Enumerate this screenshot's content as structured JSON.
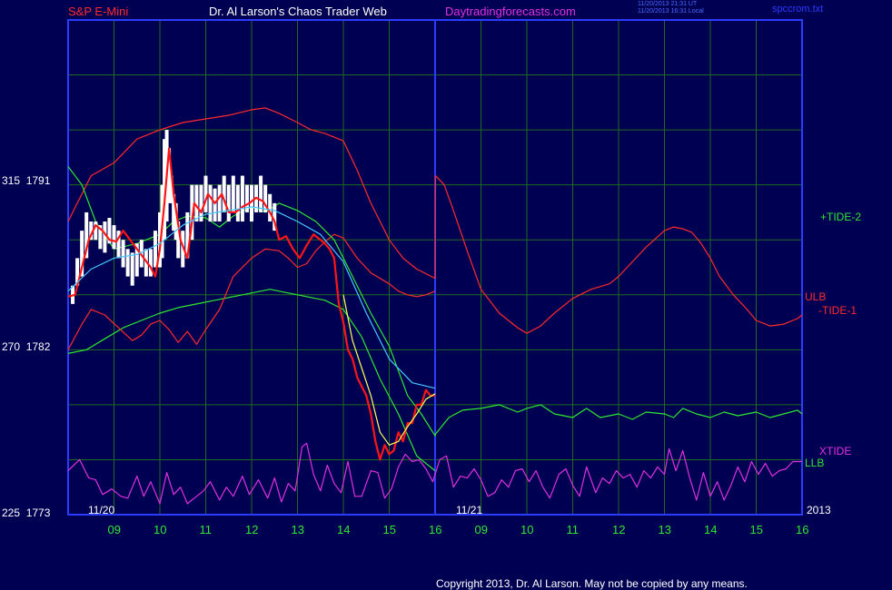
{
  "header": {
    "symbol": "S&P E-Mini",
    "title": "Dr. Al Larson's Chaos Trader Web",
    "site": "Daytradingforecasts.com",
    "stamp_line1": "11/20/2013 21:31 UT",
    "stamp_line2": "11/20/2013 16:31 Local",
    "file": "spccrom.txt"
  },
  "footer": {
    "copyright": "Copyright 2013, Dr. Al Larson. May not be copied by any means."
  },
  "colors": {
    "background": "#000052",
    "frame": "#2a3cff",
    "grid": "#1f6a1f",
    "price": "#ff1515",
    "candle_up": "#ffffff",
    "avg": "#ffff55",
    "ma_cyan": "#44c8ff",
    "tide2": "#2ee82e",
    "tide1": "#ff2a2a",
    "xtide": "#e030e0"
  },
  "chart_data": {
    "type": "line",
    "ylabels": [
      {
        "tide": "315",
        "price": "1791",
        "value": 1791
      },
      {
        "tide": "270",
        "price": "1782",
        "value": 1782
      },
      {
        "tide": "225",
        "price": "1773",
        "value": 1773
      }
    ],
    "ylim": [
      1773,
      1800
    ],
    "xlim": [
      8,
      24
    ],
    "grid": true,
    "date_labels": [
      {
        "text": "11/20",
        "x": 8.5
      },
      {
        "text": "11/21",
        "x": 16.5
      },
      {
        "text": "2013",
        "x": 24
      }
    ],
    "xticks": [
      {
        "label": "09",
        "x": 9
      },
      {
        "label": "10",
        "x": 10
      },
      {
        "label": "11",
        "x": 11
      },
      {
        "label": "12",
        "x": 12
      },
      {
        "label": "13",
        "x": 13
      },
      {
        "label": "14",
        "x": 14
      },
      {
        "label": "15",
        "x": 15
      },
      {
        "label": "16",
        "x": 16
      },
      {
        "label": "09",
        "x": 17
      },
      {
        "label": "10",
        "x": 18
      },
      {
        "label": "11",
        "x": 19
      },
      {
        "label": "12",
        "x": 20
      },
      {
        "label": "13",
        "x": 21
      },
      {
        "label": "14",
        "x": 22
      },
      {
        "label": "15",
        "x": 23
      },
      {
        "label": "16",
        "x": 24
      }
    ],
    "divider_x": 16,
    "series_labels": [
      {
        "name": "+TIDE-2",
        "color": "#2ee82e"
      },
      {
        "name": "ULB",
        "color": "#ff2a2a"
      },
      {
        "name": "-TIDE-1",
        "color": "#ff2a2a"
      },
      {
        "name": "XTIDE",
        "color": "#e030e0"
      },
      {
        "name": "LLB",
        "color": "#2ee82e"
      }
    ],
    "price": {
      "x": [
        8.0,
        8.15,
        8.3,
        8.45,
        8.6,
        8.75,
        8.9,
        9.05,
        9.2,
        9.35,
        9.5,
        9.65,
        9.8,
        9.9,
        10.0,
        10.1,
        10.2,
        10.3,
        10.45,
        10.6,
        10.75,
        10.9,
        11.05,
        11.2,
        11.35,
        11.5,
        11.65,
        11.8,
        11.95,
        12.1,
        12.25,
        12.4,
        12.5,
        12.6,
        12.75,
        12.9,
        13.05,
        13.2,
        13.35,
        13.5,
        13.6,
        13.7,
        13.8,
        13.9,
        14.0,
        14.1,
        14.2,
        14.3,
        14.4,
        14.5,
        14.6,
        14.7,
        14.8,
        14.9,
        15.0,
        15.1,
        15.2,
        15.3,
        15.4,
        15.5,
        15.6,
        15.7,
        15.8,
        15.9,
        16.0
      ],
      "y": [
        1784.9,
        1785.0,
        1786.5,
        1788.0,
        1788.8,
        1788.5,
        1788.0,
        1787.9,
        1788.5,
        1788.0,
        1787.5,
        1787.0,
        1786.5,
        1786.0,
        1787.5,
        1790.0,
        1793.0,
        1790.5,
        1788.0,
        1787.0,
        1790.0,
        1789.5,
        1790.5,
        1790.0,
        1790.5,
        1789.5,
        1789.5,
        1789.8,
        1790.0,
        1790.3,
        1790.1,
        1789.5,
        1789.0,
        1788.0,
        1788.2,
        1787.5,
        1787.0,
        1787.7,
        1788.3,
        1788.0,
        1787.8,
        1787.5,
        1787.0,
        1784.5,
        1783.5,
        1782.0,
        1781.5,
        1780.5,
        1780.0,
        1779.5,
        1778.5,
        1777.0,
        1776.0,
        1776.8,
        1776.3,
        1776.5,
        1777.5,
        1777.0,
        1778.0,
        1778.0,
        1779.0,
        1779.0,
        1779.8,
        1779.5,
        1779.5
      ]
    },
    "candles": {
      "x": [
        8.1,
        8.2,
        8.3,
        8.4,
        8.5,
        8.6,
        8.7,
        8.8,
        8.9,
        9.0,
        9.1,
        9.2,
        9.3,
        9.4,
        9.5,
        9.6,
        9.7,
        9.8,
        9.9,
        10.0,
        10.05,
        10.1,
        10.15,
        10.2,
        10.25,
        10.3,
        10.35,
        10.4,
        10.5,
        10.6,
        10.7,
        10.8,
        10.9,
        11.0,
        11.1,
        11.2,
        11.3,
        11.4,
        11.5,
        11.6,
        11.7,
        11.8,
        11.9,
        12.0,
        12.1,
        12.2,
        12.3,
        12.4,
        12.5
      ],
      "low": [
        1784.5,
        1785.5,
        1786.0,
        1787.0,
        1788.0,
        1788.0,
        1787.5,
        1787.3,
        1787.8,
        1787.5,
        1787.0,
        1786.5,
        1786.0,
        1785.5,
        1786.0,
        1786.5,
        1786.0,
        1786.0,
        1786.5,
        1786.5,
        1787.0,
        1788.0,
        1789.0,
        1790.0,
        1790.0,
        1788.5,
        1788.0,
        1787.0,
        1786.5,
        1787.0,
        1788.0,
        1789.0,
        1789.0,
        1789.5,
        1789.0,
        1789.0,
        1789.0,
        1789.5,
        1789.0,
        1789.5,
        1789.0,
        1789.0,
        1789.5,
        1789.0,
        1789.5,
        1789.5,
        1789.5,
        1789.0,
        1788.5
      ],
      "high": [
        1785.5,
        1787.0,
        1788.5,
        1789.5,
        1789.0,
        1789.0,
        1788.8,
        1789.0,
        1789.2,
        1788.8,
        1788.5,
        1788.0,
        1787.5,
        1787.3,
        1787.8,
        1788.0,
        1787.5,
        1787.5,
        1788.5,
        1789.5,
        1791.0,
        1793.5,
        1794.0,
        1793.0,
        1791.5,
        1790.5,
        1790.0,
        1789.0,
        1788.5,
        1789.5,
        1791.0,
        1791.0,
        1791.0,
        1791.5,
        1791.0,
        1790.8,
        1791.0,
        1791.5,
        1791.0,
        1791.5,
        1791.0,
        1791.5,
        1791.0,
        1791.0,
        1791.0,
        1791.5,
        1791.0,
        1790.5,
        1790.0
      ]
    },
    "avg": {
      "x": [
        14.0,
        14.2,
        14.4,
        14.6,
        14.8,
        15.0,
        15.2,
        15.4,
        15.6,
        15.8,
        16.0
      ],
      "y": [
        1785.0,
        1782.5,
        1781.0,
        1779.5,
        1777.5,
        1776.8,
        1777.0,
        1777.8,
        1778.5,
        1779.3,
        1779.6
      ]
    },
    "ma_cyan": {
      "x": [
        8.0,
        8.5,
        9.0,
        9.5,
        10.0,
        10.5,
        11.0,
        11.5,
        12.0,
        12.5,
        13.0,
        13.5,
        14.0,
        14.5,
        15.0,
        15.5,
        16.0
      ],
      "y": [
        1785.2,
        1786.4,
        1787.0,
        1787.2,
        1787.8,
        1788.8,
        1789.4,
        1789.6,
        1789.8,
        1789.6,
        1789.0,
        1788.3,
        1786.8,
        1784.0,
        1781.5,
        1780.2,
        1779.9
      ]
    },
    "tide2": {
      "x": [
        8.0,
        8.3,
        8.6,
        9.0,
        9.5,
        10.0,
        10.3,
        10.6,
        11.0,
        11.3,
        11.6,
        12.0,
        12.3,
        12.6,
        13.0,
        13.4,
        13.8,
        14.2,
        14.6,
        15.0,
        15.4,
        15.7,
        16.0,
        16.01,
        16.3,
        16.6,
        17.0,
        17.4,
        17.8,
        18.0,
        18.3,
        18.6,
        19.0,
        19.3,
        19.6,
        20.0,
        20.3,
        20.6,
        21.0,
        21.2,
        21.4,
        21.7,
        22.0,
        22.3,
        22.6,
        23.0,
        23.3,
        23.6,
        23.9,
        24.0
      ],
      "y": [
        1792.0,
        1791.0,
        1789.0,
        1787.5,
        1787.8,
        1788.3,
        1789.0,
        1789.3,
        1789.2,
        1788.7,
        1789.3,
        1789.8,
        1789.5,
        1790.0,
        1789.6,
        1789.0,
        1788.0,
        1786.0,
        1784.0,
        1782.2,
        1779.5,
        1778.5,
        1777.3,
        1777.4,
        1778.3,
        1778.7,
        1778.8,
        1779.0,
        1778.6,
        1778.8,
        1779.0,
        1778.5,
        1778.3,
        1778.8,
        1778.3,
        1778.5,
        1778.2,
        1778.6,
        1778.5,
        1778.3,
        1778.8,
        1778.5,
        1778.3,
        1778.6,
        1778.4,
        1778.6,
        1778.3,
        1778.5,
        1778.7,
        1778.5
      ]
    },
    "ulb": {
      "x": [
        8.0,
        8.5,
        9.0,
        9.5,
        10.0,
        10.5,
        11.0,
        11.5,
        12.0,
        12.3,
        12.6,
        13.0,
        13.3,
        13.6,
        14.0,
        14.3,
        14.6,
        15.0,
        15.3,
        15.6,
        16.0,
        16.01,
        16.2,
        16.4,
        16.7,
        17.0,
        17.4,
        17.8,
        18.0,
        18.3,
        18.6,
        19.0,
        19.4,
        19.8,
        20.0,
        20.3,
        20.6,
        21.0,
        21.2,
        21.4,
        21.6,
        21.8,
        22.0,
        22.2,
        22.5,
        22.8,
        23.0,
        23.3,
        23.6,
        23.9,
        24.0
      ],
      "y": [
        1789.0,
        1791.5,
        1792.2,
        1793.5,
        1794.0,
        1794.4,
        1794.6,
        1794.8,
        1795.1,
        1795.2,
        1794.9,
        1794.4,
        1794.0,
        1793.8,
        1793.4,
        1791.8,
        1790.0,
        1788.0,
        1787.0,
        1786.4,
        1785.9,
        1791.5,
        1791.0,
        1789.6,
        1787.4,
        1785.3,
        1784.0,
        1783.2,
        1782.9,
        1783.3,
        1784.0,
        1784.8,
        1785.3,
        1785.6,
        1786.0,
        1786.8,
        1787.6,
        1788.5,
        1788.7,
        1788.6,
        1788.4,
        1787.8,
        1787.0,
        1786.0,
        1785.0,
        1784.2,
        1783.6,
        1783.3,
        1783.4,
        1783.7,
        1783.9
      ]
    },
    "llb": {
      "x": [
        8.0,
        8.4,
        8.8,
        9.2,
        9.6,
        10.0,
        10.4,
        10.8,
        11.2,
        11.6,
        12.0,
        12.4,
        12.8,
        13.2,
        13.6,
        14.0,
        14.4,
        14.8,
        15.2,
        15.6,
        16.0
      ],
      "y": [
        1781.8,
        1782.0,
        1782.6,
        1783.2,
        1783.6,
        1784.0,
        1784.3,
        1784.5,
        1784.7,
        1784.9,
        1785.1,
        1785.3,
        1785.1,
        1784.9,
        1784.7,
        1784.2,
        1782.7,
        1780.4,
        1778.5,
        1776.2,
        1775.4
      ]
    },
    "tide1": {
      "x": [
        8.0,
        8.3,
        8.5,
        8.8,
        9.1,
        9.4,
        9.6,
        9.8,
        10.0,
        10.2,
        10.4,
        10.6,
        10.8,
        11.0,
        11.3,
        11.6,
        12.0,
        12.3,
        12.6,
        12.8,
        13.0,
        13.2,
        13.4,
        13.6,
        13.8,
        14.0,
        14.3,
        14.6,
        15.0,
        15.2,
        15.4,
        15.6,
        15.8,
        16.0
      ],
      "y": [
        1782.0,
        1783.4,
        1784.2,
        1783.9,
        1783.2,
        1782.5,
        1782.8,
        1783.4,
        1783.6,
        1783.1,
        1782.4,
        1783.0,
        1782.3,
        1783.1,
        1784.2,
        1786.0,
        1787.0,
        1787.5,
        1787.4,
        1787.0,
        1786.5,
        1786.7,
        1787.4,
        1787.9,
        1788.3,
        1788.1,
        1787.0,
        1786.2,
        1785.6,
        1785.2,
        1785.0,
        1784.9,
        1785.0,
        1785.2
      ]
    },
    "xtide": {
      "x": [
        8.0,
        8.25,
        8.45,
        8.6,
        8.75,
        8.95,
        9.15,
        9.3,
        9.5,
        9.65,
        9.8,
        10.0,
        10.15,
        10.3,
        10.45,
        10.6,
        10.75,
        10.95,
        11.1,
        11.3,
        11.45,
        11.6,
        11.8,
        11.95,
        12.15,
        12.35,
        12.5,
        12.65,
        12.8,
        12.95,
        13.1,
        13.2,
        13.35,
        13.5,
        13.65,
        13.8,
        13.95,
        14.1,
        14.25,
        14.4,
        14.6,
        14.75,
        14.9,
        15.05,
        15.2,
        15.35,
        15.5,
        15.65,
        15.8,
        15.95,
        16.1,
        16.25,
        16.4,
        16.55,
        16.7,
        16.85,
        17.0,
        17.15,
        17.3,
        17.45,
        17.6,
        17.75,
        17.9,
        18.05,
        18.2,
        18.35,
        18.5,
        18.7,
        18.85,
        19.0,
        19.15,
        19.3,
        19.5,
        19.65,
        19.8,
        19.95,
        20.1,
        20.25,
        20.4,
        20.55,
        20.7,
        20.85,
        21.0,
        21.1,
        21.25,
        21.4,
        21.55,
        21.7,
        21.85,
        22.0,
        22.15,
        22.3,
        22.45,
        22.6,
        22.75,
        22.9,
        23.05,
        23.2,
        23.35,
        23.5,
        23.65,
        23.8,
        24.0
      ],
      "y": [
        1775.4,
        1776.0,
        1775.0,
        1774.9,
        1774.1,
        1774.4,
        1774.0,
        1773.9,
        1775.1,
        1774.0,
        1774.8,
        1773.6,
        1775.3,
        1774.1,
        1774.5,
        1773.6,
        1773.9,
        1774.3,
        1774.8,
        1773.8,
        1774.5,
        1774.0,
        1775.1,
        1774.1,
        1774.9,
        1773.9,
        1775.0,
        1773.7,
        1774.7,
        1774.3,
        1776.7,
        1776.9,
        1775.2,
        1774.3,
        1775.7,
        1774.7,
        1774.2,
        1775.9,
        1774.0,
        1774.0,
        1775.4,
        1775.3,
        1773.9,
        1774.4,
        1775.6,
        1776.3,
        1775.9,
        1776.0,
        1775.5,
        1774.8,
        1776.0,
        1776.2,
        1774.5,
        1775.1,
        1775.0,
        1775.5,
        1774.9,
        1774.0,
        1774.2,
        1774.9,
        1774.5,
        1775.4,
        1775.5,
        1774.8,
        1775.4,
        1774.5,
        1773.9,
        1775.2,
        1775.5,
        1774.6,
        1774.0,
        1775.6,
        1774.2,
        1775.0,
        1774.7,
        1775.4,
        1775.0,
        1775.2,
        1774.5,
        1775.4,
        1775.0,
        1775.6,
        1775.2,
        1776.6,
        1775.4,
        1776.5,
        1775.0,
        1773.8,
        1775.3,
        1774.0,
        1774.8,
        1773.8,
        1774.6,
        1775.6,
        1774.8,
        1775.9,
        1775.2,
        1775.8,
        1775.1,
        1775.4,
        1775.5,
        1775.9,
        1775.9
      ]
    }
  }
}
